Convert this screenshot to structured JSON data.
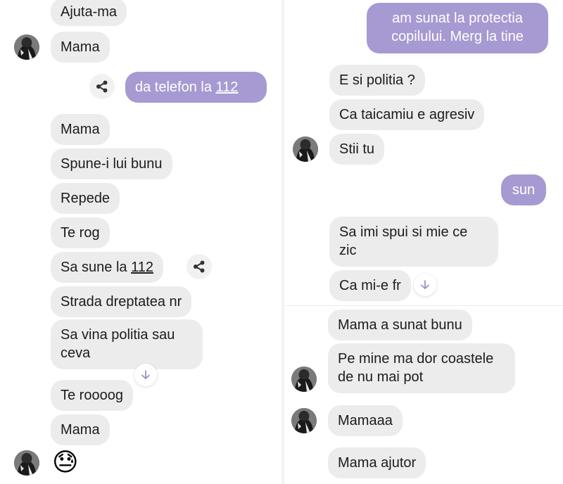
{
  "left_chat": {
    "messages": [
      {
        "text": "Ajuta-ma"
      },
      {
        "text": "Mama"
      },
      {
        "text": "Mama"
      },
      {
        "text": "Spune-i lui bunu"
      },
      {
        "text": "Repede"
      },
      {
        "text": "Te rog"
      },
      {
        "text_before": "Sa sune la ",
        "number": "112"
      },
      {
        "text": "Strada dreptatea nr"
      },
      {
        "text": "Sa vina politia sau ceva"
      },
      {
        "text": "Te roooog"
      },
      {
        "text": "Mama"
      }
    ],
    "sent": [
      {
        "text_before": "da telefon la ",
        "number": "112"
      }
    ],
    "emoji": "😓"
  },
  "right_chat": {
    "sent": [
      {
        "text": "am sunat la protectia copilului. Merg la tine"
      },
      {
        "text": "sun"
      }
    ],
    "messages": [
      {
        "text": "E si politia ?"
      },
      {
        "text": "Ca taicamiu e agresiv"
      },
      {
        "text": "Stii tu"
      },
      {
        "text": "Sa imi spui si mie ce zic"
      },
      {
        "text": "Ca mi-e fr"
      },
      {
        "text": "Mama a sunat bunu"
      },
      {
        "text": "Pe mine ma dor coastele de nu mai pot"
      },
      {
        "text": "Mamaaa"
      },
      {
        "text": "Mama ajutor"
      }
    ]
  },
  "colors": {
    "sent_bubble": "#a79ad2",
    "received_bubble": "#ececec",
    "text": "#1c1c1c"
  },
  "icons": [
    "share-icon",
    "scroll-down-arrow-icon",
    "avatar"
  ]
}
